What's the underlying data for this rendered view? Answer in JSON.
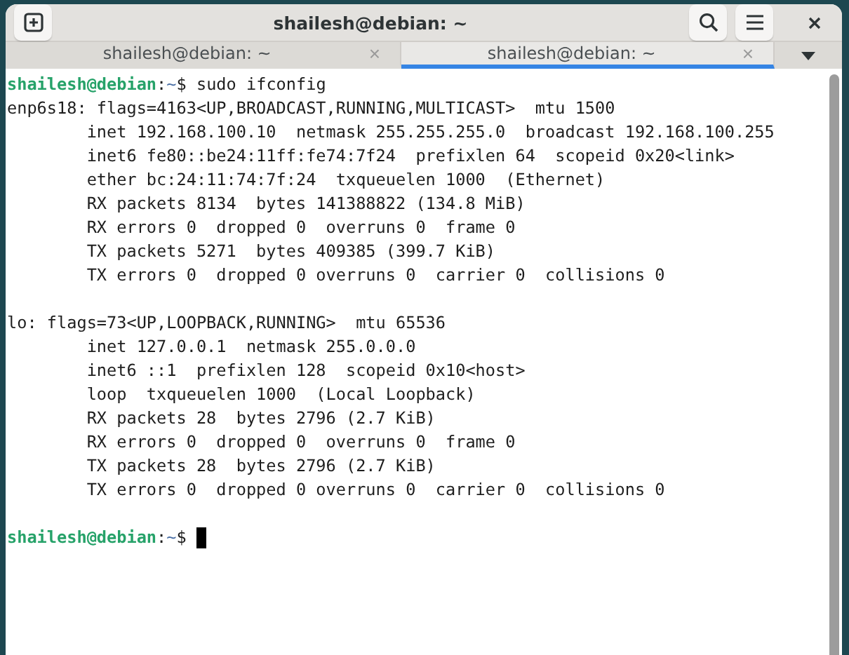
{
  "window": {
    "title": "shailesh@debian: ~"
  },
  "tabs": [
    {
      "label": "shailesh@debian: ~",
      "close": "×",
      "selected": false
    },
    {
      "label": "shailesh@debian: ~",
      "close": "×",
      "selected": true
    }
  ],
  "terminal": {
    "lines": [
      {
        "kind": "prompt",
        "user": "shailesh@debian",
        "sep": ":",
        "path": "~",
        "symbol": "$",
        "command": " sudo ifconfig",
        "cursor": false
      },
      {
        "kind": "output",
        "text": "enp6s18: flags=4163<UP,BROADCAST,RUNNING,MULTICAST>  mtu 1500"
      },
      {
        "kind": "output",
        "text": "        inet 192.168.100.10  netmask 255.255.255.0  broadcast 192.168.100.255"
      },
      {
        "kind": "output",
        "text": "        inet6 fe80::be24:11ff:fe74:7f24  prefixlen 64  scopeid 0x20<link>"
      },
      {
        "kind": "output",
        "text": "        ether bc:24:11:74:7f:24  txqueuelen 1000  (Ethernet)"
      },
      {
        "kind": "output",
        "text": "        RX packets 8134  bytes 141388822 (134.8 MiB)"
      },
      {
        "kind": "output",
        "text": "        RX errors 0  dropped 0  overruns 0  frame 0"
      },
      {
        "kind": "output",
        "text": "        TX packets 5271  bytes 409385 (399.7 KiB)"
      },
      {
        "kind": "output",
        "text": "        TX errors 0  dropped 0 overruns 0  carrier 0  collisions 0"
      },
      {
        "kind": "blank"
      },
      {
        "kind": "output",
        "text": "lo: flags=73<UP,LOOPBACK,RUNNING>  mtu 65536"
      },
      {
        "kind": "output",
        "text": "        inet 127.0.0.1  netmask 255.0.0.0"
      },
      {
        "kind": "output",
        "text": "        inet6 ::1  prefixlen 128  scopeid 0x10<host>"
      },
      {
        "kind": "output",
        "text": "        loop  txqueuelen 1000  (Local Loopback)"
      },
      {
        "kind": "output",
        "text": "        RX packets 28  bytes 2796 (2.7 KiB)"
      },
      {
        "kind": "output",
        "text": "        RX errors 0  dropped 0  overruns 0  frame 0"
      },
      {
        "kind": "output",
        "text": "        TX packets 28  bytes 2796 (2.7 KiB)"
      },
      {
        "kind": "output",
        "text": "        TX errors 0  dropped 0 overruns 0  carrier 0  collisions 0"
      },
      {
        "kind": "blank"
      },
      {
        "kind": "prompt",
        "user": "shailesh@debian",
        "sep": ":",
        "path": "~",
        "symbol": "$",
        "cursor": true
      }
    ]
  }
}
